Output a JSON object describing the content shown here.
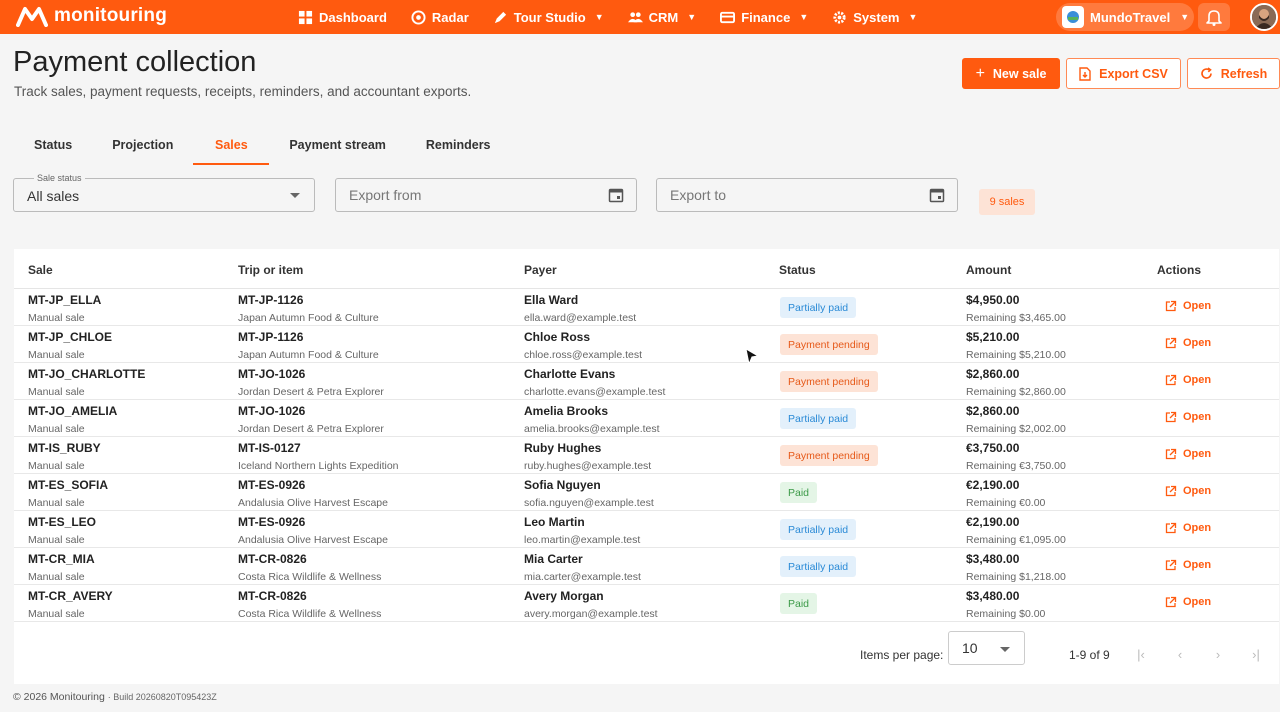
{
  "app": {
    "name": "monitouring",
    "nav": [
      {
        "label": "Dashboard",
        "icon": "dashboard-icon",
        "caret": false
      },
      {
        "label": "Radar",
        "icon": "radar-icon",
        "caret": false
      },
      {
        "label": "Tour Studio",
        "icon": "pen-icon",
        "caret": true
      },
      {
        "label": "CRM",
        "icon": "people-icon",
        "caret": true
      },
      {
        "label": "Finance",
        "icon": "card-icon",
        "caret": true
      },
      {
        "label": "System",
        "icon": "gear-icon",
        "caret": true
      }
    ],
    "org": "MundoTravel",
    "accent": "#ff5a0f"
  },
  "header": {
    "title": "Payment collection",
    "subtitle": "Track sales, payment requests, receipts, reminders, and accountant exports.",
    "new_sale": "New sale",
    "export_csv": "Export CSV",
    "refresh": "Refresh"
  },
  "tabs": [
    "Status",
    "Projection",
    "Sales",
    "Payment stream",
    "Reminders"
  ],
  "active_tab": "Sales",
  "filters": {
    "status_legend": "Sale status",
    "status_value": "All sales",
    "export_from": "Export from",
    "export_to": "Export to",
    "count": "9 sales"
  },
  "table": {
    "headers": [
      "Sale",
      "Trip or item",
      "Payer",
      "Status",
      "Amount",
      "Actions"
    ],
    "open_label": "Open",
    "rows": [
      {
        "sale": "MT-JP_ELLA",
        "sale_sub": "Manual sale",
        "trip": "MT-JP-1126",
        "trip_sub": "Japan Autumn Food & Culture",
        "payer": "Ella Ward",
        "email": "ella.ward@example.test",
        "status": "Partially paid",
        "status_kind": "partial",
        "amount": "$4,950.00",
        "remaining": "Remaining $3,465.00"
      },
      {
        "sale": "MT-JP_CHLOE",
        "sale_sub": "Manual sale",
        "trip": "MT-JP-1126",
        "trip_sub": "Japan Autumn Food & Culture",
        "payer": "Chloe Ross",
        "email": "chloe.ross@example.test",
        "status": "Payment pending",
        "status_kind": "pending",
        "amount": "$5,210.00",
        "remaining": "Remaining $5,210.00"
      },
      {
        "sale": "MT-JO_CHARLOTTE",
        "sale_sub": "Manual sale",
        "trip": "MT-JO-1026",
        "trip_sub": "Jordan Desert & Petra Explorer",
        "payer": "Charlotte Evans",
        "email": "charlotte.evans@example.test",
        "status": "Payment pending",
        "status_kind": "pending",
        "amount": "$2,860.00",
        "remaining": "Remaining $2,860.00"
      },
      {
        "sale": "MT-JO_AMELIA",
        "sale_sub": "Manual sale",
        "trip": "MT-JO-1026",
        "trip_sub": "Jordan Desert & Petra Explorer",
        "payer": "Amelia Brooks",
        "email": "amelia.brooks@example.test",
        "status": "Partially paid",
        "status_kind": "partial",
        "amount": "$2,860.00",
        "remaining": "Remaining $2,002.00"
      },
      {
        "sale": "MT-IS_RUBY",
        "sale_sub": "Manual sale",
        "trip": "MT-IS-0127",
        "trip_sub": "Iceland Northern Lights Expedition",
        "payer": "Ruby Hughes",
        "email": "ruby.hughes@example.test",
        "status": "Payment pending",
        "status_kind": "pending",
        "amount": "€3,750.00",
        "remaining": "Remaining €3,750.00"
      },
      {
        "sale": "MT-ES_SOFIA",
        "sale_sub": "Manual sale",
        "trip": "MT-ES-0926",
        "trip_sub": "Andalusia Olive Harvest Escape",
        "payer": "Sofia Nguyen",
        "email": "sofia.nguyen@example.test",
        "status": "Paid",
        "status_kind": "paid",
        "amount": "€2,190.00",
        "remaining": "Remaining €0.00"
      },
      {
        "sale": "MT-ES_LEO",
        "sale_sub": "Manual sale",
        "trip": "MT-ES-0926",
        "trip_sub": "Andalusia Olive Harvest Escape",
        "payer": "Leo Martin",
        "email": "leo.martin@example.test",
        "status": "Partially paid",
        "status_kind": "partial",
        "amount": "€2,190.00",
        "remaining": "Remaining €1,095.00"
      },
      {
        "sale": "MT-CR_MIA",
        "sale_sub": "Manual sale",
        "trip": "MT-CR-0826",
        "trip_sub": "Costa Rica Wildlife & Wellness",
        "payer": "Mia Carter",
        "email": "mia.carter@example.test",
        "status": "Partially paid",
        "status_kind": "partial",
        "amount": "$3,480.00",
        "remaining": "Remaining $1,218.00"
      },
      {
        "sale": "MT-CR_AVERY",
        "sale_sub": "Manual sale",
        "trip": "MT-CR-0826",
        "trip_sub": "Costa Rica Wildlife & Wellness",
        "payer": "Avery Morgan",
        "email": "avery.morgan@example.test",
        "status": "Paid",
        "status_kind": "paid",
        "amount": "$3,480.00",
        "remaining": "Remaining $0.00"
      }
    ]
  },
  "pagination": {
    "label": "Items per page:",
    "per_page": "10",
    "range": "1-9 of 9"
  },
  "footer": {
    "copyright": "© 2026 Monitouring",
    "build": "· Build 20260820T095423Z"
  }
}
